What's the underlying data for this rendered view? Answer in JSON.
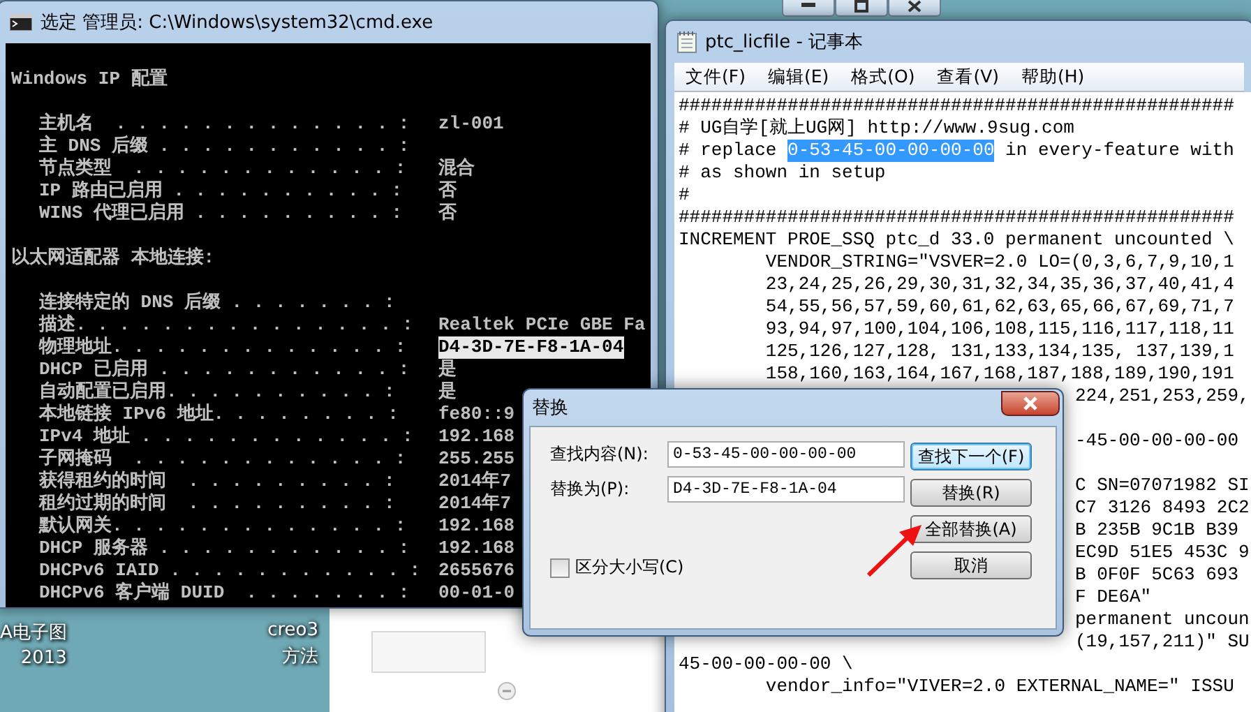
{
  "cmd_window": {
    "title": "选定 管理员: C:\\Windows\\system32\\cmd.exe",
    "lines": [
      {
        "kind": "heading",
        "text": "Windows IP 配置"
      },
      {
        "kind": "row",
        "label": "主机名  . . . . . . . . . . . . . :",
        "value": "zl-001",
        "highlighted": false
      },
      {
        "kind": "row",
        "label": "主 DNS 后缀 . . . . . . . . . . . :"
      },
      {
        "kind": "row",
        "label": "节点类型  . . . . . . . . . . . . :",
        "value": "混合",
        "highlighted": false
      },
      {
        "kind": "row",
        "label": "IP 路由已启用 . . . . . . . . . . :",
        "value": "否",
        "highlighted": false
      },
      {
        "kind": "row",
        "label": "WINS 代理已启用 . . . . . . . . . :",
        "value": "否",
        "highlighted": false
      },
      {
        "kind": "heading",
        "text": "以太网适配器 本地连接:"
      },
      {
        "kind": "row",
        "label": "连接特定的 DNS 后缀 . . . . . . . :"
      },
      {
        "kind": "row",
        "label": "描述. . . . . . . . . . . . . . . :",
        "value": "Realtek PCIe GBE Fa",
        "highlighted": false
      },
      {
        "kind": "row",
        "label": "物理地址. . . . . . . . . . . . . :",
        "value": "D4-3D-7E-F8-1A-04",
        "highlighted": true
      },
      {
        "kind": "row",
        "label": "DHCP 已启用 . . . . . . . . . . . :",
        "value": "是",
        "highlighted": false
      },
      {
        "kind": "row",
        "label": "自动配置已启用. . . . . . . . . . :",
        "value": "是",
        "highlighted": false
      },
      {
        "kind": "row",
        "label": "本地链接 IPv6 地址. . . . . . . . :",
        "value": "fe80::9",
        "highlighted": false
      },
      {
        "kind": "row",
        "label": "IPv4 地址 . . . . . . . . . . . . :",
        "value": "192.168",
        "highlighted": false
      },
      {
        "kind": "row",
        "label": "子网掩码  . . . . . . . . . . . . :",
        "value": "255.255",
        "highlighted": false
      },
      {
        "kind": "row",
        "label": "获得租约的时间  . . . . . . . . . :",
        "value": "2014年7",
        "highlighted": false
      },
      {
        "kind": "row",
        "label": "租约过期的时间  . . . . . . . . . :",
        "value": "2014年7",
        "highlighted": false
      },
      {
        "kind": "row",
        "label": "默认网关. . . . . . . . . . . . . :",
        "value": "192.168",
        "highlighted": false
      },
      {
        "kind": "row",
        "label": "DHCP 服务器 . . . . . . . . . . . :",
        "value": "192.168",
        "highlighted": false
      },
      {
        "kind": "row",
        "label": "DHCPv6 IAID . . . . . . . . . . . :",
        "value": "2655676",
        "highlighted": false
      },
      {
        "kind": "row",
        "label": "DHCPv6 客户端 DUID  . . . . . . . :",
        "value": "00-01-0",
        "highlighted": false
      }
    ]
  },
  "desktop_icons": [
    {
      "lines": [
        "A电子图",
        "2013"
      ]
    },
    {
      "lines": [
        "creo3",
        "方法"
      ]
    }
  ],
  "notepad": {
    "title": "ptc_licfile - 记事本",
    "menu": [
      "文件(F)",
      "编辑(E)",
      "格式(O)",
      "查看(V)",
      "帮助(H)"
    ],
    "lines": [
      {
        "kind": "text",
        "text": "###################################################"
      },
      {
        "kind": "text",
        "text": "# UG自学[就上UG网] http://www.9sug.com"
      },
      {
        "kind": "selection",
        "before": "# replace ",
        "selected": "0-53-45-00-00-00-00",
        "after": " in every-feature with"
      },
      {
        "kind": "text",
        "text": "# as shown in setup"
      },
      {
        "kind": "text",
        "text": "#"
      },
      {
        "kind": "text",
        "text": "###################################################"
      },
      {
        "kind": "text",
        "text": "INCREMENT PROE_SSQ ptc_d 33.0 permanent uncounted \\"
      },
      {
        "kind": "text",
        "text": "        VENDOR_STRING=\"VSVER=2.0 LO=(0,3,6,7,9,10,1"
      },
      {
        "kind": "text",
        "text": "        23,24,25,26,29,30,31,32,34,35,36,37,40,41,4"
      },
      {
        "kind": "text",
        "text": "        54,55,56,57,59,60,61,62,63,65,66,67,69,71,7"
      },
      {
        "kind": "text",
        "text": "        93,94,97,100,104,106,108,115,116,117,118,11"
      },
      {
        "kind": "text",
        "text": "        125,126,127,128, 131,133,134,135, 137,139,1"
      },
      {
        "kind": "text",
        "text": "        158,160,163,164,167,168,187,188,189,190,191"
      },
      {
        "kind": "tail",
        "text": "224,251,253,259,"
      },
      {
        "kind": "gap"
      },
      {
        "kind": "tail",
        "text": "-45-00-00-00-00"
      },
      {
        "kind": "gap"
      },
      {
        "kind": "tail",
        "text": "C SN=07071982 SI"
      },
      {
        "kind": "tail",
        "text": "C7 3126 8493 2C2"
      },
      {
        "kind": "tail",
        "text": "B 235B 9C1B B39"
      },
      {
        "kind": "tail",
        "text": "EC9D 51E5 453C 9"
      },
      {
        "kind": "tail",
        "text": "B 0F0F 5C63 693"
      },
      {
        "kind": "tail",
        "text": "F DE6A\""
      },
      {
        "kind": "tail",
        "text": "permanent uncoun"
      },
      {
        "kind": "tail",
        "text": "(19,157,211)\" SU"
      },
      {
        "kind": "text",
        "text": "45-00-00-00-00 \\"
      },
      {
        "kind": "text",
        "text": "        vendor_info=\"VIVER=2.0 EXTERNAL_NAME=\" ISSU"
      }
    ]
  },
  "replace_dialog": {
    "title": "替换",
    "fields": [
      {
        "label": "查找内容(N):",
        "value": "0-53-45-00-00-00-00"
      },
      {
        "label": "替换为(P):",
        "value": "D4-3D-7E-F8-1A-04"
      }
    ],
    "checkbox": {
      "label": "区分大小写(C)",
      "checked": false
    },
    "buttons": [
      {
        "label": "查找下一个(F)",
        "default": true
      },
      {
        "label": "替换(R)",
        "default": false
      },
      {
        "label": "全部替换(A)",
        "default": false
      },
      {
        "label": "取消",
        "default": false
      }
    ]
  }
}
